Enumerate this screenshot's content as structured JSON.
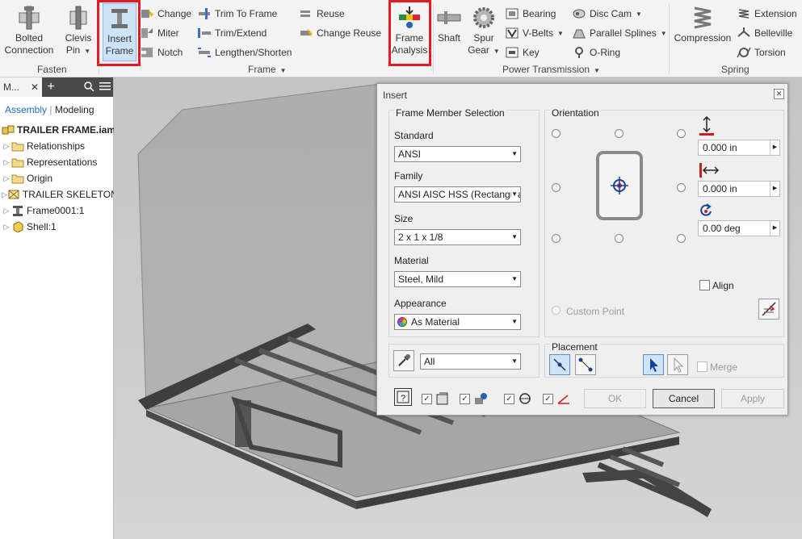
{
  "ribbon": {
    "fasten": {
      "group_label": "Fasten",
      "bolted": [
        "Bolted",
        "Connection"
      ],
      "clevis": [
        "Clevis",
        "Pin"
      ]
    },
    "frame": {
      "group_label": "Frame",
      "insert": [
        "Insert",
        "Frame"
      ],
      "change": "Change",
      "miter": "Miter",
      "notch": "Notch",
      "trim_to_frame": "Trim To Frame",
      "trim_extend": "Trim/Extend",
      "lengthen": "Lengthen/Shorten",
      "reuse": "Reuse",
      "change_reuse": "Change Reuse",
      "analysis": [
        "Frame",
        "Analysis"
      ]
    },
    "power": {
      "group_label": "Power Transmission",
      "shaft": "Shaft",
      "spur": [
        "Spur",
        "Gear"
      ],
      "bearing": "Bearing",
      "vbelts": "V-Belts",
      "key": "Key",
      "disc_cam": "Disc Cam",
      "parallel_splines": "Parallel Splines",
      "oring": "O-Ring"
    },
    "spring": {
      "group_label": "Spring",
      "compression": "Compression",
      "extension": "Extension",
      "belleville": "Belleville",
      "torsion": "Torsion"
    }
  },
  "browser": {
    "tab_label": "M...",
    "close": "✕",
    "plus": "+",
    "tab_assembly": "Assembly",
    "tab_modeling": "Modeling",
    "root": "TRAILER FRAME.iam",
    "items": [
      {
        "label": "Relationships"
      },
      {
        "label": "Representations"
      },
      {
        "label": "Origin"
      },
      {
        "label": "TRAILER SKELETON:"
      },
      {
        "label": "Frame0001:1"
      },
      {
        "label": "Shell:1"
      }
    ]
  },
  "dialog": {
    "title": "Insert",
    "close": "✕",
    "frame_member": {
      "heading": "Frame Member Selection",
      "standard_label": "Standard",
      "standard_value": "ANSI",
      "family_label": "Family",
      "family_value": "ANSI AISC HSS (Rectangula",
      "size_label": "Size",
      "size_value": "2 x 1 x 1/8",
      "material_label": "Material",
      "material_value": "Steel, Mild",
      "appearance_label": "Appearance",
      "appearance_value": "As Material"
    },
    "filter_value": "All",
    "orientation": {
      "heading": "Orientation",
      "offset_v": "0.000 in",
      "offset_h": "0.000 in",
      "rotation": "0.00 deg",
      "custom_point": "Custom Point",
      "align": "Align"
    },
    "placement": {
      "heading": "Placement",
      "merge": "Merge"
    },
    "buttons": {
      "ok": "OK",
      "cancel": "Cancel",
      "apply": "Apply"
    }
  },
  "colors": {
    "highlight": "#e01b24",
    "accent": "#1a6fc4"
  }
}
